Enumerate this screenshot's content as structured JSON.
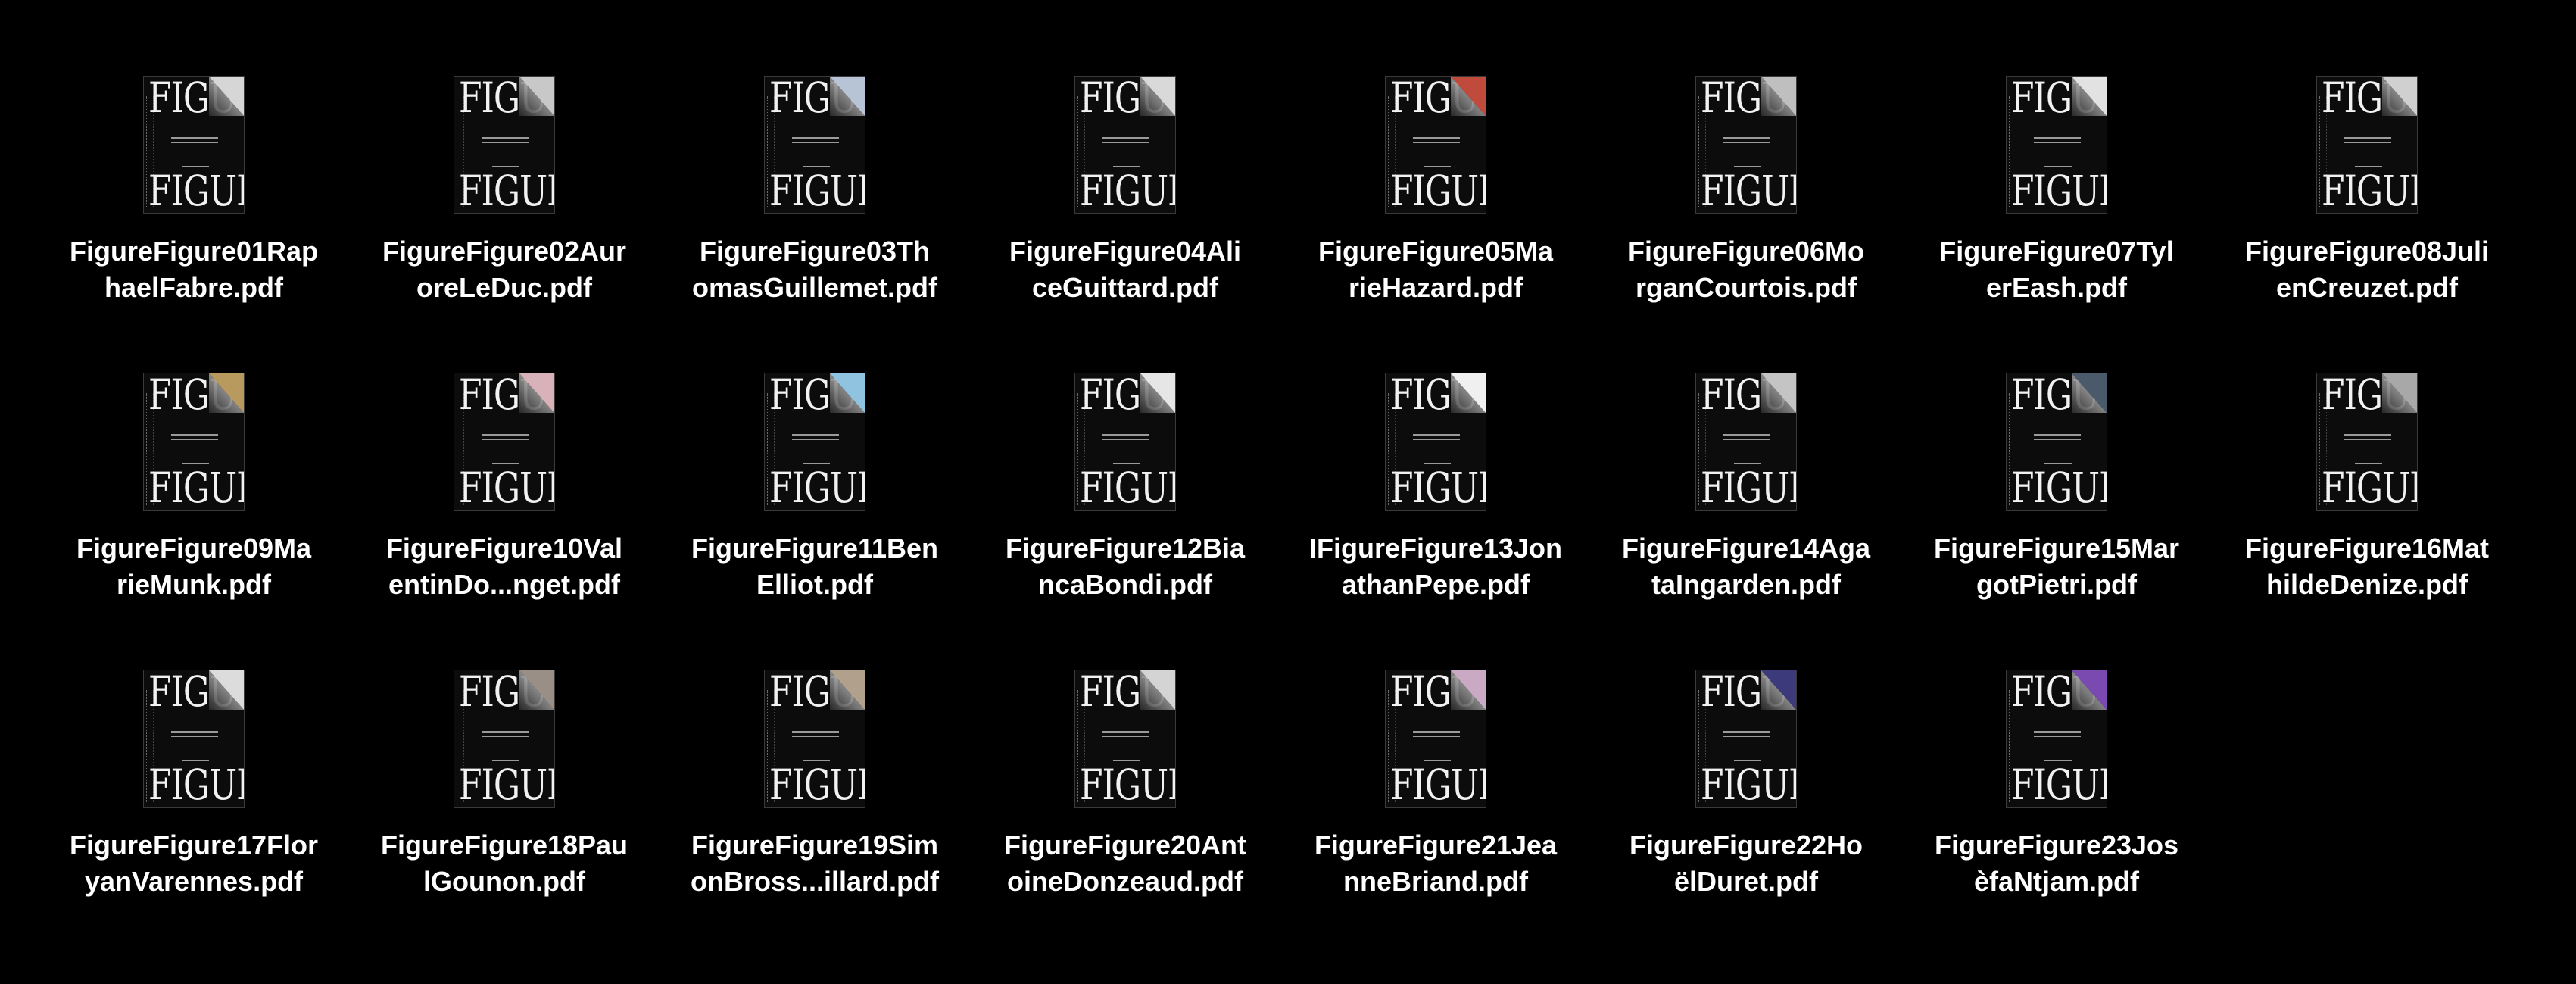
{
  "files": [
    {
      "name_line1": "FigureFigure01Rap",
      "name_line2": "haelFabre.pdf",
      "accent": "#d6d6d6",
      "thumb_icon": "magazine-cover-thumbnail"
    },
    {
      "name_line1": "FigureFigure02Aur",
      "name_line2": "oreLeDuc.pdf",
      "accent": "#c8c8c8",
      "thumb_icon": "magazine-cover-thumbnail"
    },
    {
      "name_line1": "FigureFigure03Th",
      "name_line2": "omasGuillemet.pdf",
      "accent": "#b7c4d6",
      "thumb_icon": "magazine-cover-thumbnail"
    },
    {
      "name_line1": "FigureFigure04Ali",
      "name_line2": "ceGuittard.pdf",
      "accent": "#d9d9d9",
      "thumb_icon": "magazine-cover-thumbnail"
    },
    {
      "name_line1": "FigureFigure05Ma",
      "name_line2": "rieHazard.pdf",
      "accent": "#c04a3c",
      "thumb_icon": "magazine-cover-thumbnail"
    },
    {
      "name_line1": "FigureFigure06Mo",
      "name_line2": "rganCourtois.pdf",
      "accent": "#bfbfbf",
      "thumb_icon": "magazine-cover-thumbnail"
    },
    {
      "name_line1": "FigureFigure07Tyl",
      "name_line2": "erEash.pdf",
      "accent": "#e2e2e2",
      "thumb_icon": "magazine-cover-thumbnail"
    },
    {
      "name_line1": "FigureFigure08Juli",
      "name_line2": "enCreuzet.pdf",
      "accent": "#d0d0d0",
      "thumb_icon": "magazine-cover-thumbnail"
    },
    {
      "name_line1": "FigureFigure09Ma",
      "name_line2": "rieMunk.pdf",
      "accent": "#b8995e",
      "thumb_icon": "magazine-cover-thumbnail"
    },
    {
      "name_line1": "FigureFigure10Val",
      "name_line2": "entinDo...nget.pdf",
      "accent": "#d8b2b8",
      "thumb_icon": "magazine-cover-thumbnail"
    },
    {
      "name_line1": "FigureFigure11Ben",
      "name_line2": "Elliot.pdf",
      "accent": "#8fc3e0",
      "thumb_icon": "magazine-cover-thumbnail"
    },
    {
      "name_line1": "FigureFigure12Bia",
      "name_line2": "ncaBondi.pdf",
      "accent": "#e6e6e6",
      "thumb_icon": "magazine-cover-thumbnail"
    },
    {
      "name_line1": "IFigureFigure13Jon",
      "name_line2": "athanPepe.pdf",
      "accent": "#f0f0f0",
      "thumb_icon": "magazine-cover-thumbnail"
    },
    {
      "name_line1": "FigureFigure14Aga",
      "name_line2": "taIngarden.pdf",
      "accent": "#c4c4c4",
      "thumb_icon": "magazine-cover-thumbnail"
    },
    {
      "name_line1": "FigureFigure15Mar",
      "name_line2": "gotPietri.pdf",
      "accent": "#4a5a6a",
      "thumb_icon": "magazine-cover-thumbnail"
    },
    {
      "name_line1": "FigureFigure16Mat",
      "name_line2": "hildeDenize.pdf",
      "accent": "#a8a8a8",
      "thumb_icon": "magazine-cover-thumbnail"
    },
    {
      "name_line1": "FigureFigure17Flor",
      "name_line2": "yanVarennes.pdf",
      "accent": "#dcdcdc",
      "thumb_icon": "magazine-cover-thumbnail"
    },
    {
      "name_line1": "FigureFigure18Pau",
      "name_line2": "lGounon.pdf",
      "accent": "#9a8f86",
      "thumb_icon": "magazine-cover-thumbnail"
    },
    {
      "name_line1": "FigureFigure19Sim",
      "name_line2": "onBross...illard.pdf",
      "accent": "#b0a08c",
      "thumb_icon": "magazine-cover-thumbnail"
    },
    {
      "name_line1": "FigureFigure20Ant",
      "name_line2": "oineDonzeaud.pdf",
      "accent": "#d4d4d4",
      "thumb_icon": "magazine-cover-thumbnail"
    },
    {
      "name_line1": "FigureFigure21Jea",
      "name_line2": "nneBriand.pdf",
      "accent": "#c9a9c4",
      "thumb_icon": "magazine-cover-thumbnail"
    },
    {
      "name_line1": "FigureFigure22Ho",
      "name_line2": "ëlDuret.pdf",
      "accent": "#3c3a7a",
      "thumb_icon": "magazine-cover-thumbnail"
    },
    {
      "name_line1": "FigureFigure23Jos",
      "name_line2": "èfaNtjam.pdf",
      "accent": "#7a4ab0",
      "thumb_icon": "magazine-cover-thumbnail"
    }
  ],
  "cover": {
    "masthead_top": "FIGU",
    "masthead_bottom": "FIGURE"
  }
}
